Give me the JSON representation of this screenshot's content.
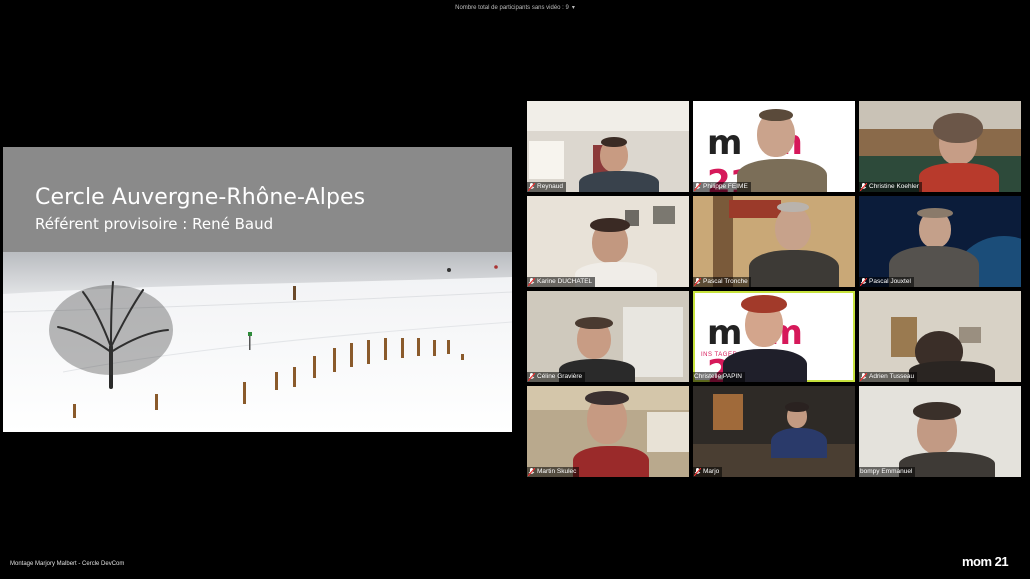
{
  "banner": {
    "participants_text": "Nombre total de participants sans vidéo : 9",
    "caret": "▾"
  },
  "slide": {
    "title": "Cercle Auvergne-Rhône-Alpes",
    "subtitle": "Référent provisoire : René Baud"
  },
  "participants": [
    {
      "name": "Reynaud"
    },
    {
      "name": "Philippe FEIME"
    },
    {
      "name": "Christine Koehler"
    },
    {
      "name": "Karine DUCHATEL"
    },
    {
      "name": "Pascal Tronche"
    },
    {
      "name": "Pascal Jouxtel"
    },
    {
      "name": "Céline Gravière"
    },
    {
      "name": "Christelle PAPIN"
    },
    {
      "name": "Adrien Tusseau"
    },
    {
      "name": "Martin Skulec"
    },
    {
      "name": "Marjo"
    },
    {
      "name": "bompy Emmanuel"
    }
  ],
  "backgrounds": {
    "mom_logo_text_1": "m",
    "mom_logo_text_2": "m 21",
    "mom_tagline": "INS                TAGER"
  },
  "footer": {
    "credit": "Montage Marjory Malbert - Cercle DevCom",
    "logo": "mom 21"
  },
  "colors": {
    "active_border": "#c7e23d",
    "mom_pink": "#d6195a"
  }
}
